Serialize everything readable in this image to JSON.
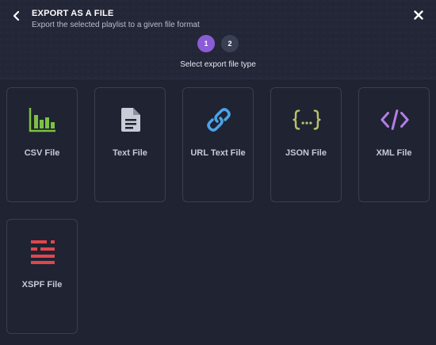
{
  "header": {
    "title": "EXPORT AS A FILE",
    "subtitle": "Export the selected playlist to a given file format",
    "back_icon": "chevron-left-icon",
    "close_icon": "close-icon"
  },
  "steps": {
    "items": [
      {
        "label": "1",
        "active": true
      },
      {
        "label": "2",
        "active": false
      }
    ],
    "current_label": "Select export file type"
  },
  "file_types": [
    {
      "label": "CSV File",
      "icon": "bar-chart-icon",
      "color": "#7cc142"
    },
    {
      "label": "Text File",
      "icon": "document-icon",
      "color": "#c7ccd6"
    },
    {
      "label": "URL Text File",
      "icon": "link-icon",
      "color": "#4aa3e8"
    },
    {
      "label": "JSON File",
      "icon": "curly-braces-icon",
      "color": "#b7c26a"
    },
    {
      "label": "XML File",
      "icon": "code-icon",
      "color": "#b47de8"
    },
    {
      "label": "XSPF File",
      "icon": "xspf-lines-icon",
      "color": "#e0474c"
    }
  ],
  "colors": {
    "accent": "#8b5cd6",
    "background": "#1f2332"
  }
}
